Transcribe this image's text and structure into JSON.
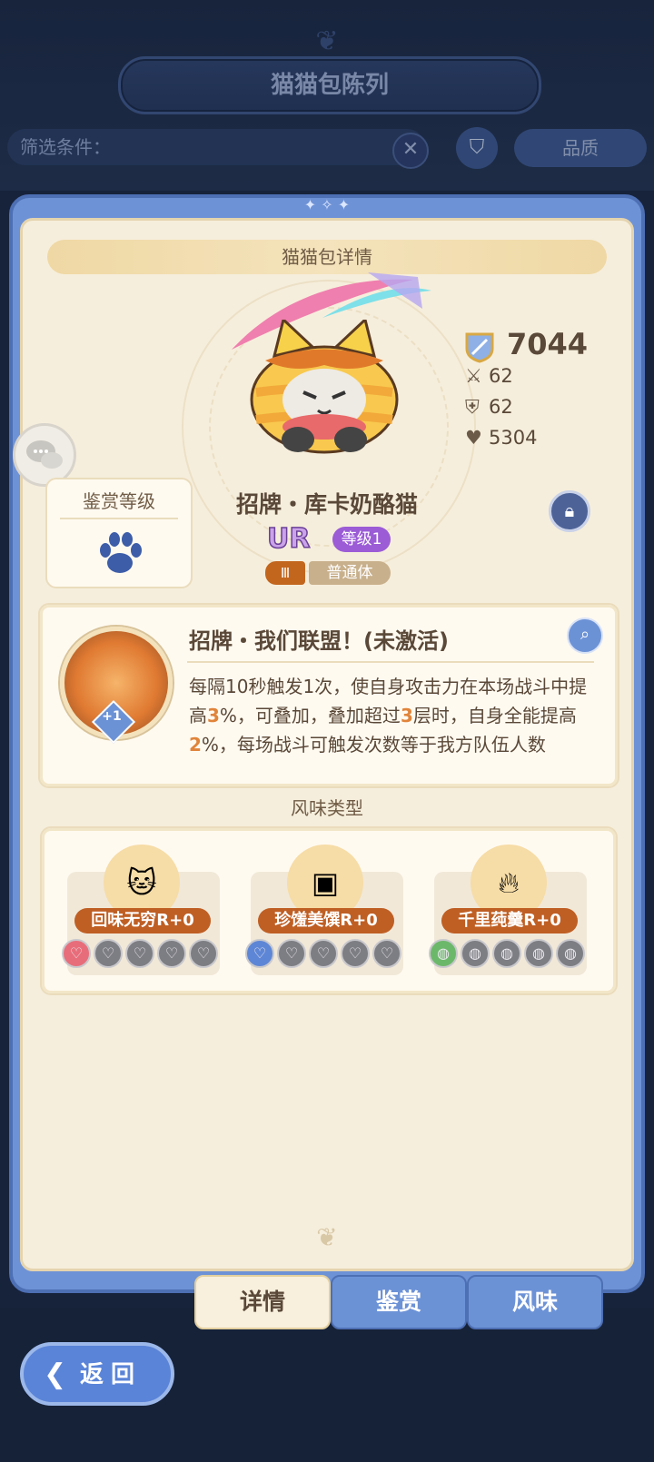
{
  "header": {
    "title": "猫猫包陈列"
  },
  "filter": {
    "label": "筛选条件：",
    "clear_icon": "✕",
    "sort_label": "品质"
  },
  "panel": {
    "header": "猫猫包详情"
  },
  "character": {
    "name": "招牌・库卡奶酪猫",
    "rarity": "UR",
    "level": "等级1",
    "tier": "Ⅲ",
    "body_type": "普通体",
    "power": "7044",
    "attack": "62",
    "defense": "62",
    "hp": "5304"
  },
  "appraisal": {
    "title": "鉴赏等级"
  },
  "skill": {
    "title": "招牌・我们联盟！(未激活)",
    "plus": "+1",
    "desc_1": "每隔10秒触发1次，使自身攻击力在本场战斗中提高",
    "hl_1": "3",
    "desc_2": "%，可叠加，叠加超过",
    "hl_2": "3",
    "desc_3": "层时，自身全能提高",
    "hl_3": "2",
    "desc_4": "%，每场战斗可触发次数等于我方队伍人数"
  },
  "flavor": {
    "title": "风味类型",
    "items": [
      {
        "label": "回味无穷R+0",
        "icon": "cat-face-icon"
      },
      {
        "label": "珍馐美馔R+0",
        "icon": "dish-icon"
      },
      {
        "label": "千里莼羹R+0",
        "icon": "flame-icon"
      }
    ]
  },
  "tabs": [
    "详情",
    "鉴赏",
    "风味"
  ],
  "back": {
    "label": "返回"
  },
  "colors": {
    "accent_blue": "#6c92d6",
    "panel_bg": "#f6eedc",
    "ur_purple": "#9b5cd6",
    "flavor_orange": "#bf5f24"
  }
}
